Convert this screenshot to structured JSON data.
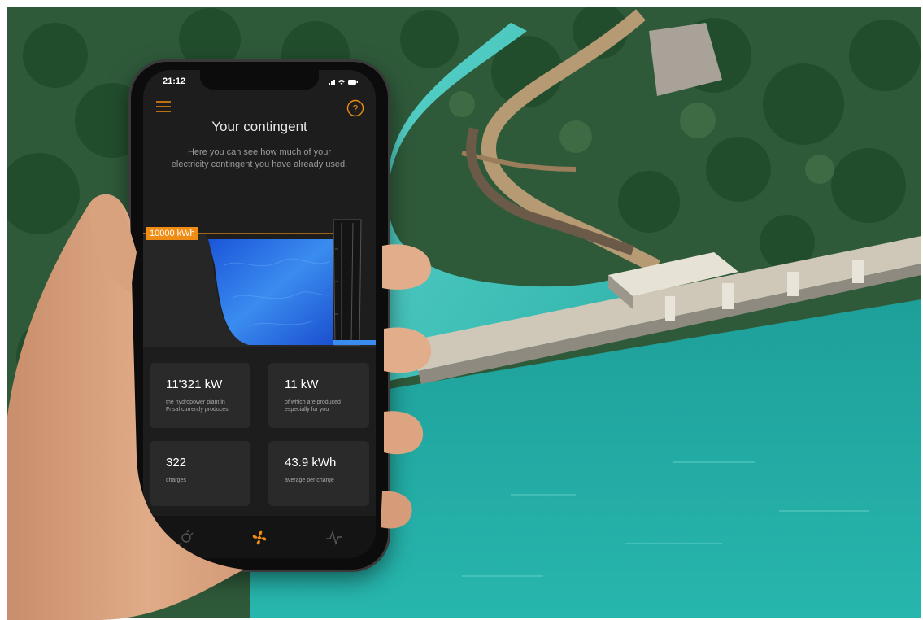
{
  "status_bar": {
    "time": "21:12"
  },
  "header": {
    "title": "Your contingent",
    "subtitle": "Here you can see how much of your electricity contingent you have already used."
  },
  "reservoir": {
    "capacity_label": "10000 kWh",
    "fill_fraction": 0.95
  },
  "stats": [
    {
      "value": "11'321 kW",
      "label": "the hydropower plant in Frisal currently produces"
    },
    {
      "value": "11 kW",
      "label": "of which are produced especially for you"
    },
    {
      "value": "322",
      "label": "charges"
    },
    {
      "value": "43.9 kWh",
      "label": "average per charge"
    }
  ],
  "nav": {
    "items": [
      {
        "icon": "plug-icon",
        "active": false
      },
      {
        "icon": "turbine-icon",
        "active": true
      },
      {
        "icon": "activity-icon",
        "active": false
      }
    ]
  },
  "colors": {
    "accent": "#f08c14",
    "screen_bg": "#1d1d1d",
    "card_bg": "#2a2a2a",
    "water": "#2a6fe0"
  }
}
